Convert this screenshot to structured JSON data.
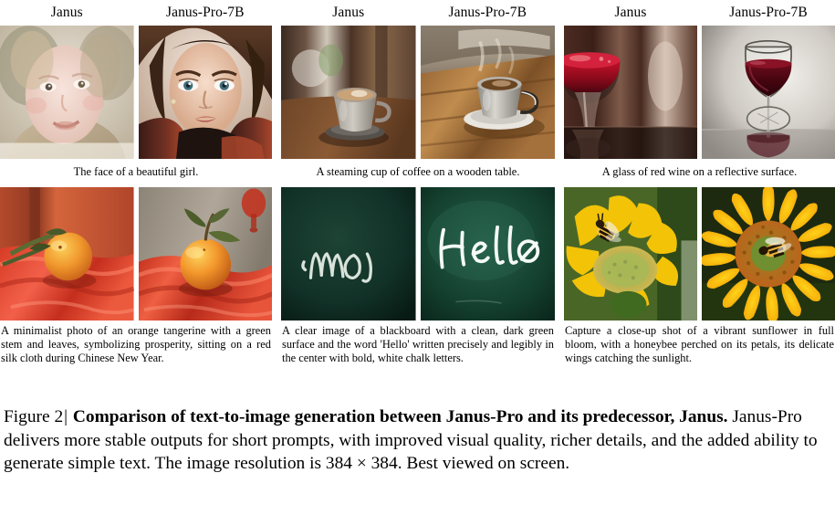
{
  "figure": {
    "columns": [
      {
        "id": "col-1",
        "headers": [
          "Janus",
          "Janus-Pro-7B"
        ],
        "top_prompt": "The face of a beautiful girl.",
        "bottom_prompt": "A minimalist photo of an orange tangerine with a green stem and leaves, symbolizing prosperity, sitting on a red silk cloth during Chinese New Year.",
        "top_images": [
          "girl-face-janus",
          "girl-face-janus-pro-7b"
        ],
        "bottom_images": [
          "tangerine-red-silk-janus",
          "tangerine-red-silk-janus-pro-7b"
        ]
      },
      {
        "id": "col-2",
        "headers": [
          "Janus",
          "Janus-Pro-7B"
        ],
        "top_prompt": "A steaming cup of coffee on a wooden table.",
        "bottom_prompt": "A clear image of a blackboard with a clean, dark green surface and the word 'Hello' written precisely and legibly in the center with bold, white chalk letters.",
        "top_images": [
          "coffee-cup-janus",
          "coffee-cup-janus-pro-7b"
        ],
        "bottom_images": [
          "blackboard-scribble-janus",
          "blackboard-hello-janus-pro-7b"
        ],
        "chalk_text_janus": "MNOJ",
        "chalk_text_janus_pro": "Hello"
      },
      {
        "id": "col-3",
        "headers": [
          "Janus",
          "Janus-Pro-7B"
        ],
        "top_prompt": "A glass of red wine on a reflective surface.",
        "bottom_prompt": "Capture a close-up shot of a vibrant sunflower in full bloom, with a honeybee perched on its petals, its delicate wings catching the sunlight.",
        "top_images": [
          "wine-glass-janus",
          "wine-glass-janus-pro-7b"
        ],
        "bottom_images": [
          "sunflower-bee-janus",
          "sunflower-bee-janus-pro-7b"
        ]
      }
    ],
    "caption": {
      "label": "Figure 2",
      "separator": "|",
      "bold_part": "Comparison of text-to-image generation between Janus-Pro and its predecessor, Janus.",
      "rest": " Janus-Pro delivers more stable outputs for short prompts, with improved visual quality, richer details, and the added ability to generate simple text. The image resolution is 384 × 384. Best viewed on screen."
    }
  }
}
